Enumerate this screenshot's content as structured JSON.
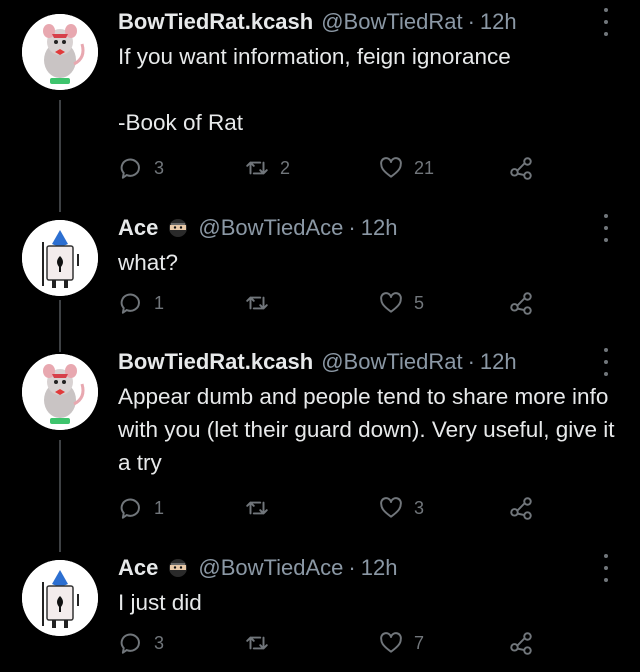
{
  "tweets": [
    {
      "display_name": "BowTiedRat.kcash",
      "handle": "@BowTiedRat",
      "separator": "·",
      "time": "12h",
      "text": "If you want information, feign ignorance\n\n-Book of Rat",
      "replies": "3",
      "retweets": "2",
      "likes": "21",
      "avatar": "rat-avatar"
    },
    {
      "display_name": "Ace",
      "handle": "@BowTiedAce",
      "separator": "·",
      "time": "12h",
      "text": "what?",
      "replies": "1",
      "retweets": "",
      "likes": "5",
      "avatar": "ace-avatar",
      "badge": "ninja-emoji"
    },
    {
      "display_name": "BowTiedRat.kcash",
      "handle": "@BowTiedRat",
      "separator": "·",
      "time": "12h",
      "text": "Appear dumb and people tend to share more info with you (let their guard down). Very useful, give it a try",
      "replies": "1",
      "retweets": "",
      "likes": "3",
      "avatar": "rat-avatar"
    },
    {
      "display_name": "Ace",
      "handle": "@BowTiedAce",
      "separator": "·",
      "time": "12h",
      "text": "I just did",
      "replies": "3",
      "retweets": "",
      "likes": "7",
      "avatar": "ace-avatar",
      "badge": "ninja-emoji"
    }
  ],
  "colors": {
    "background": "#000000",
    "text": "#e7e9ea",
    "secondary": "#8b98a5",
    "icon": "#71767b",
    "thread_line": "#3e4144"
  }
}
